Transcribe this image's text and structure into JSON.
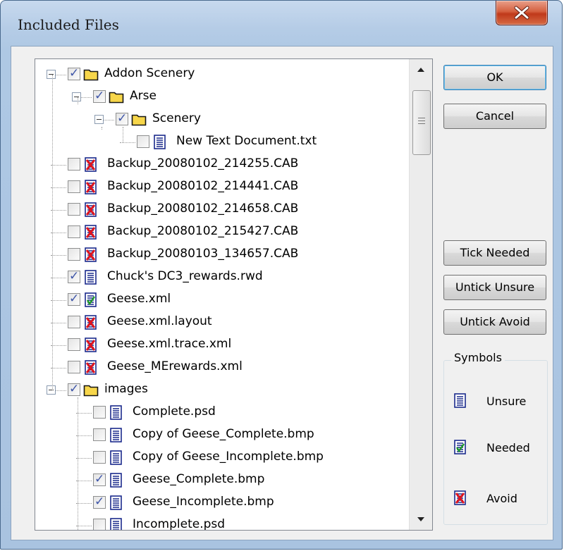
{
  "window": {
    "title": "Included Files"
  },
  "buttons": {
    "ok": "OK",
    "cancel": "Cancel",
    "tick_needed": "Tick Needed",
    "untick_unsure": "Untick Unsure",
    "untick_avoid": "Untick Avoid"
  },
  "symbols": {
    "title": "Symbols",
    "items": [
      {
        "label": "Unsure",
        "icon": "unsure-doc-icon"
      },
      {
        "label": "Needed",
        "icon": "needed-doc-icon"
      },
      {
        "label": "Avoid",
        "icon": "avoid-doc-icon"
      }
    ]
  },
  "tree": {
    "items": [
      {
        "label": "Addon Scenery",
        "level": 0,
        "type": "folder",
        "checked": true,
        "expander": true
      },
      {
        "label": "Arse",
        "level": 1,
        "type": "folder",
        "checked": true,
        "expander": true
      },
      {
        "label": "Scenery",
        "level": 2,
        "type": "folder",
        "checked": true,
        "expander": true
      },
      {
        "label": "New Text Document.txt",
        "level": 3,
        "type": "unsure",
        "checked": false
      },
      {
        "label": "Backup_20080102_214255.CAB",
        "level": 0,
        "type": "avoid",
        "checked": false
      },
      {
        "label": "Backup_20080102_214441.CAB",
        "level": 0,
        "type": "avoid",
        "checked": false
      },
      {
        "label": "Backup_20080102_214658.CAB",
        "level": 0,
        "type": "avoid",
        "checked": false
      },
      {
        "label": "Backup_20080102_215427.CAB",
        "level": 0,
        "type": "avoid",
        "checked": false
      },
      {
        "label": "Backup_20080103_134657.CAB",
        "level": 0,
        "type": "avoid",
        "checked": false
      },
      {
        "label": "Chuck's DC3_rewards.rwd",
        "level": 0,
        "type": "unsure",
        "checked": true
      },
      {
        "label": "Geese.xml",
        "level": 0,
        "type": "needed",
        "checked": true
      },
      {
        "label": "Geese.xml.layout",
        "level": 0,
        "type": "avoid",
        "checked": false
      },
      {
        "label": "Geese.xml.trace.xml",
        "level": 0,
        "type": "avoid",
        "checked": false
      },
      {
        "label": "Geese_MErewards.xml",
        "level": 0,
        "type": "avoid",
        "checked": false
      },
      {
        "label": "images",
        "level": 0,
        "type": "folder",
        "checked": true,
        "expander": true
      },
      {
        "label": "Complete.psd",
        "level": 1,
        "type": "unsure",
        "checked": false
      },
      {
        "label": "Copy of Geese_Complete.bmp",
        "level": 1,
        "type": "unsure",
        "checked": false
      },
      {
        "label": "Copy of Geese_Incomplete.bmp",
        "level": 1,
        "type": "unsure",
        "checked": false
      },
      {
        "label": "Geese_Complete.bmp",
        "level": 1,
        "type": "unsure",
        "checked": true
      },
      {
        "label": "Geese_Incomplete.bmp",
        "level": 1,
        "type": "unsure",
        "checked": true
      },
      {
        "label": "Incomplete.psd",
        "level": 1,
        "type": "unsure",
        "checked": false
      }
    ]
  }
}
